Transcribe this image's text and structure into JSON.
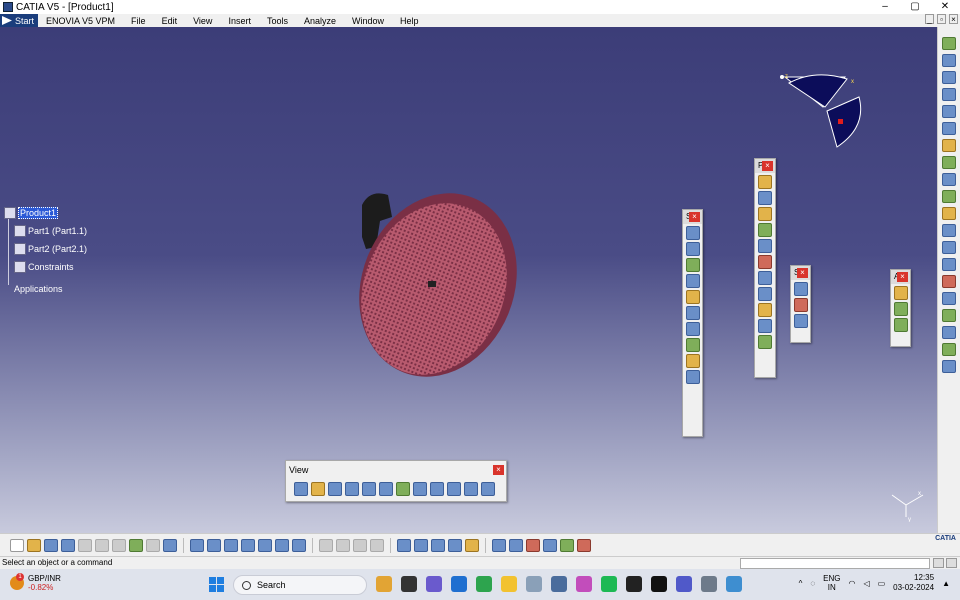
{
  "window": {
    "title": "CATIA V5 - [Product1]",
    "controls": [
      "–",
      "▢",
      "✕"
    ]
  },
  "menubar": {
    "start": "Start",
    "items": [
      "ENOVIA V5 VPM",
      "File",
      "Edit",
      "View",
      "Insert",
      "Tools",
      "Analyze",
      "Window",
      "Help"
    ],
    "mdi_controls": [
      "_",
      "▫",
      "×"
    ]
  },
  "tree": {
    "root": "Product1",
    "children": [
      "Part1 (Part1.1)",
      "Part2 (Part2.1)",
      "Constraints"
    ],
    "applications": "Applications"
  },
  "panels": {
    "view": {
      "title": "View",
      "close": "×"
    },
    "p1": {
      "title": "S",
      "close": "×"
    },
    "p2": {
      "title": "P",
      "close": "×"
    },
    "p3": {
      "title": "S",
      "close": "×"
    },
    "p4": {
      "title": "A",
      "close": "×"
    }
  },
  "compass": {
    "x_label": "x",
    "z_label": "z"
  },
  "axis": {
    "x": "x",
    "y": "y"
  },
  "catia_logo": "CATIA",
  "status": {
    "message": "Select an object or a command"
  },
  "taskbar": {
    "stock_name": "GBP/INR",
    "stock_change": "-0.82%",
    "search_placeholder": "Search",
    "lang_top": "ENG",
    "lang_bottom": "IN",
    "time": "12:35",
    "date": "03-02-2024"
  },
  "colors": {
    "viewport_top": "#3c3d78",
    "part_red": "#b85a6e",
    "part_black": "#1c1c1c",
    "selection_blue": "#2b59d6",
    "close_red": "#d9342b"
  }
}
